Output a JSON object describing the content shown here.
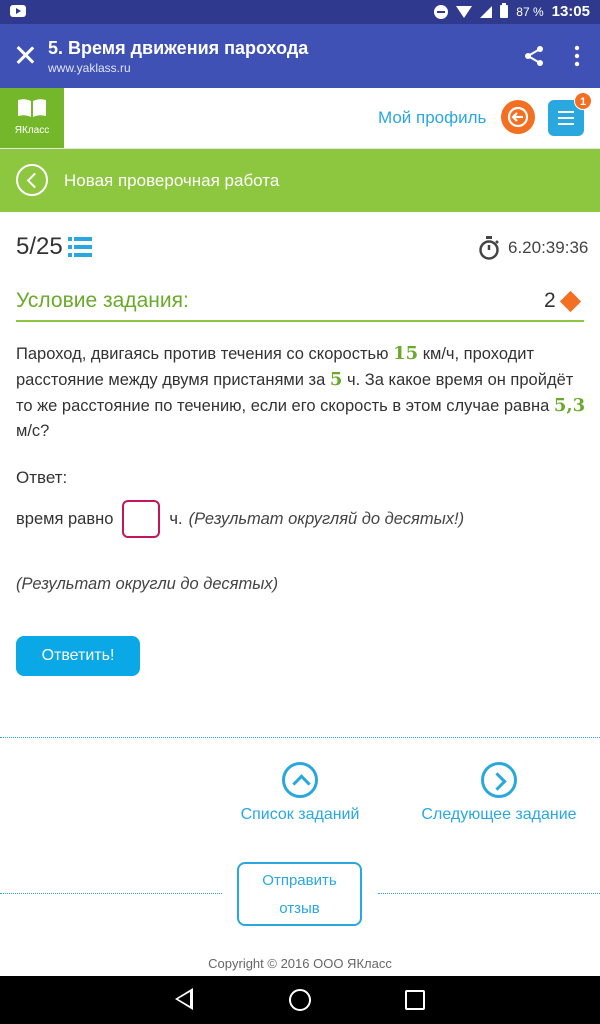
{
  "status_bar": {
    "battery": "87 %",
    "time": "13:05"
  },
  "app_bar": {
    "title": "5. Время движения парохода",
    "url": "www.yaklass.ru"
  },
  "header": {
    "logo_text": "ЯКласс",
    "profile_link": "Мой профиль",
    "notifications": "1"
  },
  "banner": {
    "title": "Новая проверочная работа"
  },
  "task": {
    "current": "5",
    "total": "/25",
    "timer": "6.20:39:36",
    "condition_title": "Условие задания:",
    "points": "2",
    "text_1": "Пароход, двигаясь против течения со скоростью ",
    "speed": "15",
    "text_2": " км/ч, проходит расстояние между двумя пристанями за ",
    "time": "5",
    "text_3": " ч. За какое время он пройдёт то же расстояние по течению, если его скорость в этом случае равна ",
    "speed2": "5,3",
    "text_4": " м/с?",
    "answer_label": "Ответ:",
    "answer_prefix": "время равно",
    "answer_value": "",
    "answer_unit": "ч.",
    "answer_hint": "(Результат округляй до десятых!)",
    "hint2": "(Результат округли до десятых)",
    "submit_label": "Ответить!"
  },
  "footer": {
    "task_list": "Список заданий",
    "next_task": "Следующее задание",
    "feedback_line1": "Отправить",
    "feedback_line2": "отзыв",
    "copyright": "Copyright © 2016 ООО ЯКласс"
  },
  "colors": {
    "green": "#8dc63f",
    "blue": "#29a8e0",
    "orange": "#f36f21",
    "indigo": "#3f51b5"
  }
}
